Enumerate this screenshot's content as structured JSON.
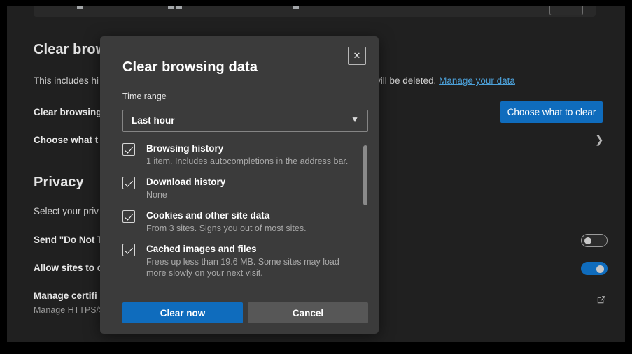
{
  "window": {
    "background_color": "#202020",
    "frame_color": "#000000"
  },
  "settings_page": {
    "clear_browsing_section": {
      "heading": "Clear browsing data",
      "description_prefix": "This includes history, passwords, cookies and more. Only data from this profile will be deleted.",
      "description_visible_left": "This includes hi",
      "description_visible_right": "will be deleted.",
      "manage_link": "Manage your data",
      "rows": [
        {
          "label": "Clear browsing data",
          "label_visible": "Clear browsing",
          "action_button": "Choose what to clear"
        },
        {
          "label": "Choose what to clear every time you close the browser",
          "label_visible": "Choose what t",
          "chevron": "chevron-right-icon"
        }
      ]
    },
    "privacy_section": {
      "heading": "Privacy",
      "description": "Select your privacy settings for Microsoft Edge",
      "description_visible": "Select your priv",
      "rows": [
        {
          "label": "Send \"Do Not Track\" requests",
          "label_visible": "Send \"Do Not T",
          "control": "toggle",
          "state": "off"
        },
        {
          "label": "Allow sites to check if you have payment methods saved",
          "label_visible": "Allow sites to c",
          "control": "toggle",
          "state": "on"
        },
        {
          "label": "Manage certificates",
          "label_visible": "Manage certifi",
          "sublabel": "Manage HTTPS/SSL certificates and settings",
          "sublabel_visible": "Manage HTTPS/S",
          "control": "external-link"
        }
      ]
    }
  },
  "dialog": {
    "title": "Clear browsing data",
    "close_label": "✕",
    "time_range": {
      "label": "Time range",
      "selected": "Last hour",
      "chevron": "chevron-down-icon"
    },
    "options": [
      {
        "title": "Browsing history",
        "description": "1 item. Includes autocompletions in the address bar.",
        "checked": true
      },
      {
        "title": "Download history",
        "description": "None",
        "checked": true
      },
      {
        "title": "Cookies and other site data",
        "description": "From 3 sites. Signs you out of most sites.",
        "checked": true
      },
      {
        "title": "Cached images and files",
        "description": "Frees up less than 19.6 MB. Some sites may load more slowly on your next visit.",
        "checked": true
      }
    ],
    "primary_button": "Clear now",
    "secondary_button": "Cancel",
    "accent_color": "#0f6cbd",
    "surface_color": "#3b3b3b"
  }
}
